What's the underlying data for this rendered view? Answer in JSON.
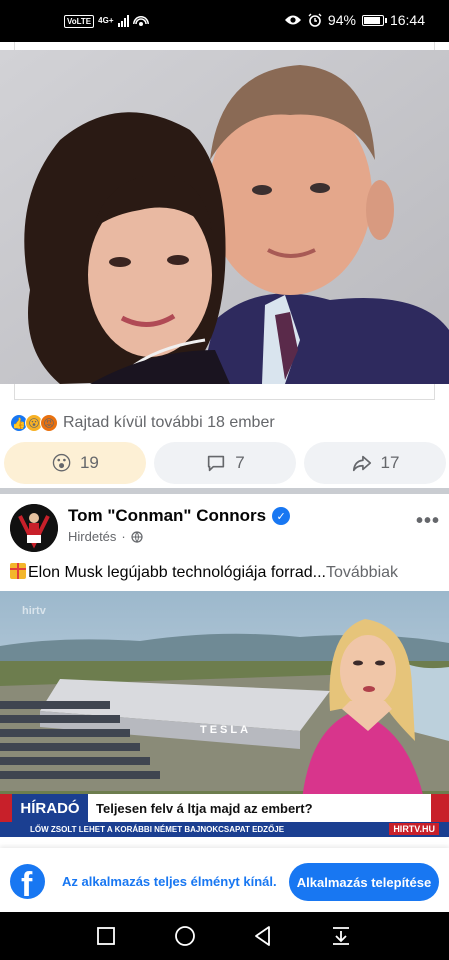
{
  "status_bar": {
    "volte": "VoLTE",
    "network": "4G+",
    "battery": "94%",
    "time": "16:44"
  },
  "post": {
    "reactions_text": "Rajtad kívül további 18 ember",
    "wow_count": "19",
    "comment_count": "7",
    "share_count": "17"
  },
  "ad": {
    "author": "Tom \"Conman\" Connors",
    "sponsored": "Hirdetés",
    "separator": "·",
    "text": "Elon Musk legújabb technológiája forrad...",
    "more_link": "Továbbiak",
    "image": {
      "watermark": "hirtv",
      "building_sign": "TESLA",
      "hirado": "HÍRADÓ",
      "headline": "Teljesen felv á ltja majd az embert?",
      "subline": "LŐW ZSOLT LEHET A KORÁBBI NÉMET BAJNOKCSAPAT EDZŐJE",
      "channel": "HIRTV.HU"
    }
  },
  "app_banner": {
    "logo_letter": "f",
    "text": "Az alkalmazás teljes élményt kínál.",
    "install": "Alkalmazás telepítése"
  },
  "colors": {
    "facebook_blue": "#1877f2",
    "wow_highlight": "#fdf0d5",
    "news_blue": "#1b3f91",
    "news_red": "#c8202a"
  }
}
